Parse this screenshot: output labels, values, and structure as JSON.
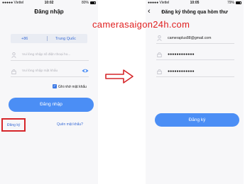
{
  "left_screen": {
    "status": {
      "carrier": "●●●●● Viettel",
      "time": "10:02",
      "battery": "80%"
    },
    "title": "Đăng nhập",
    "country_code": "+86",
    "country_name": "Trung Quốc",
    "phone_placeholder": "Vui lòng nhập số điện thoại ho...",
    "password_placeholder": "Vui lòng nhập mật khẩu",
    "remember_label": "Ghi nhớ mật khẩu",
    "login_button": "Đăng nhập",
    "register_link": "Đăng ký",
    "forgot_link": "Quên mật khẩu?"
  },
  "right_screen": {
    "status": {
      "carrier": "●●●●● Viettel",
      "time": "10:05",
      "battery": "79%"
    },
    "title": "Đăng ký thông qua hòm thư",
    "email_value": "cameraplus88@gmail.com",
    "password_value": "●●●●●●●●●●●●",
    "confirm_value": "●●●●●●●●●●●●",
    "register_button": "Đăng ký"
  },
  "watermark": "camerasaigon24h.com",
  "colors": {
    "accent": "#4b8ef5",
    "highlight": "#d6262a",
    "link": "#3b6dd6",
    "watermark": "#e02020"
  }
}
